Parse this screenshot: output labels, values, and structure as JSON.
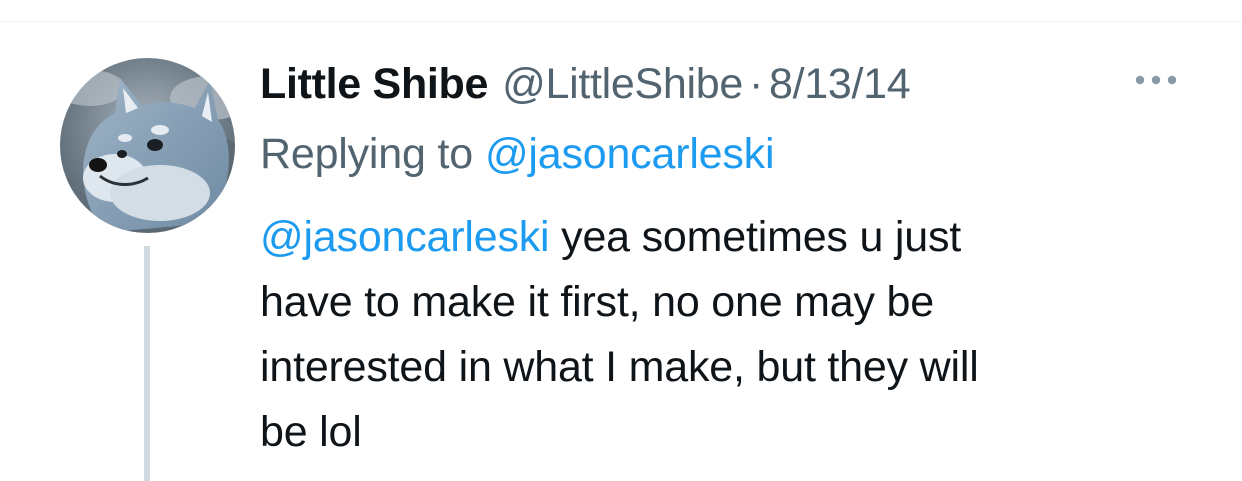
{
  "tweet": {
    "author": {
      "display_name": "Little Shibe",
      "handle": "@LittleShibe",
      "avatar_icon": "shiba-dog-avatar"
    },
    "separator": "·",
    "date": "8/13/14",
    "more_icon": "more-horizontal-icon",
    "replying": {
      "prefix": "Replying to",
      "mention": "@jasoncarleski"
    },
    "body": {
      "mention": "@jasoncarleski",
      "lines": [
        "yea sometimes u just",
        "have to make it first, no one may be",
        "interested in what I make, but they will",
        "be lol"
      ]
    }
  },
  "colors": {
    "text_primary": "#0f1419",
    "text_secondary": "#536471",
    "link": "#1d9bf0",
    "thread_line": "#cfd9de",
    "divider": "#eff3f4"
  }
}
